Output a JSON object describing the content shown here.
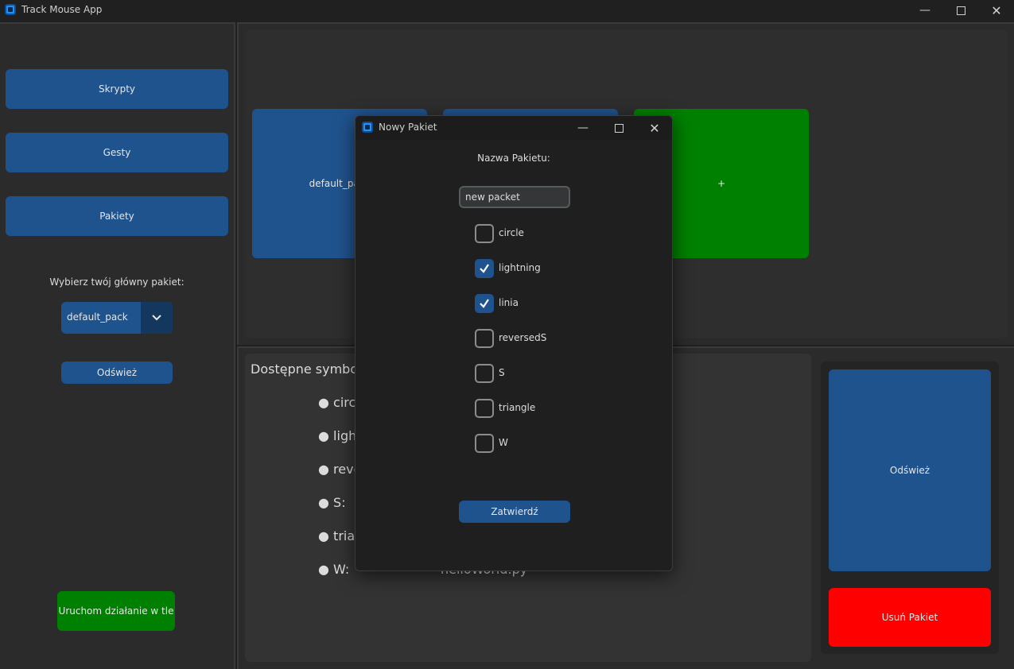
{
  "window": {
    "title": "Track Mouse App"
  },
  "window_controls": [
    "minimize",
    "maximize",
    "close"
  ],
  "sidebar": {
    "buttons": [
      "Skrypty",
      "Gesty",
      "Pakiety"
    ],
    "main_pack_label": "Wybierz twój główny pakiet:",
    "main_pack_select": {
      "value": "default_pack"
    },
    "refresh_label": "Odśwież",
    "run_background_label": "Uruchom działanie w tle"
  },
  "packs": {
    "tiles": [
      "default_pack",
      "",
      "+"
    ]
  },
  "symbols": {
    "heading": "Dostępne symbole",
    "items": [
      "● circle",
      "● lightning",
      "● reversedS",
      "● S:",
      "● triangle",
      "● W:"
    ],
    "w_script": "helloWorld.py"
  },
  "right_panel": {
    "refresh_label": "Odśwież",
    "delete_label": "Usuń Pakiet"
  },
  "dialog": {
    "title": "Nowy Pakiet",
    "name_label": "Nazwa Pakietu:",
    "name_value": "new packet",
    "checkboxes": [
      {
        "label": "circle",
        "checked": false
      },
      {
        "label": "lightning",
        "checked": true
      },
      {
        "label": "linia",
        "checked": true
      },
      {
        "label": "reversedS",
        "checked": false
      },
      {
        "label": "S",
        "checked": false
      },
      {
        "label": "triangle",
        "checked": false
      },
      {
        "label": "W",
        "checked": false
      }
    ],
    "submit_label": "Zatwierdź"
  },
  "colors": {
    "accent_blue": "#1f538d",
    "green": "#008000",
    "red": "#ff0000",
    "background": "#202020"
  }
}
